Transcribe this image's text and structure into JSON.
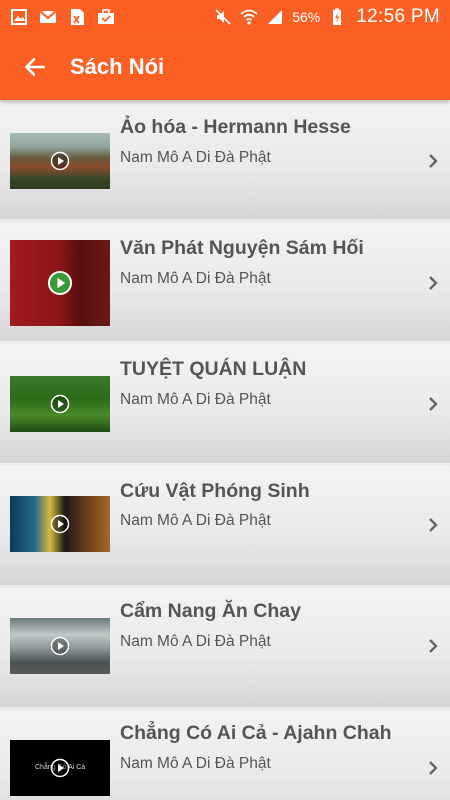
{
  "status_bar": {
    "battery": "56%",
    "time": "12:56 PM"
  },
  "app_bar": {
    "title": "Sách Nói"
  },
  "colors": {
    "accent": "#fa5f24",
    "text": "#555555"
  },
  "items": [
    {
      "title": "Ảo hóa - Hermann Hesse",
      "subtitle": "Nam Mô A Di Đà Phật"
    },
    {
      "title": "Văn Phát Nguyện Sám Hối",
      "subtitle": "Nam Mô A Di Đà Phật"
    },
    {
      "title": "TUYỆT QUÁN LUẬN",
      "subtitle": "Nam Mô A Di Đà Phật"
    },
    {
      "title": "Cứu Vật Phóng Sinh",
      "subtitle": "Nam Mô A Di Đà Phật"
    },
    {
      "title": "Cẩm Nang Ăn Chay",
      "subtitle": "Nam Mô A Di Đà Phật"
    },
    {
      "title": "Chẳng Có Ai Cả - Ajahn Chah",
      "subtitle": "Nam Mô A Di Đà Phật",
      "thumb_caption": "Chẳng Có Ai Cả"
    }
  ]
}
